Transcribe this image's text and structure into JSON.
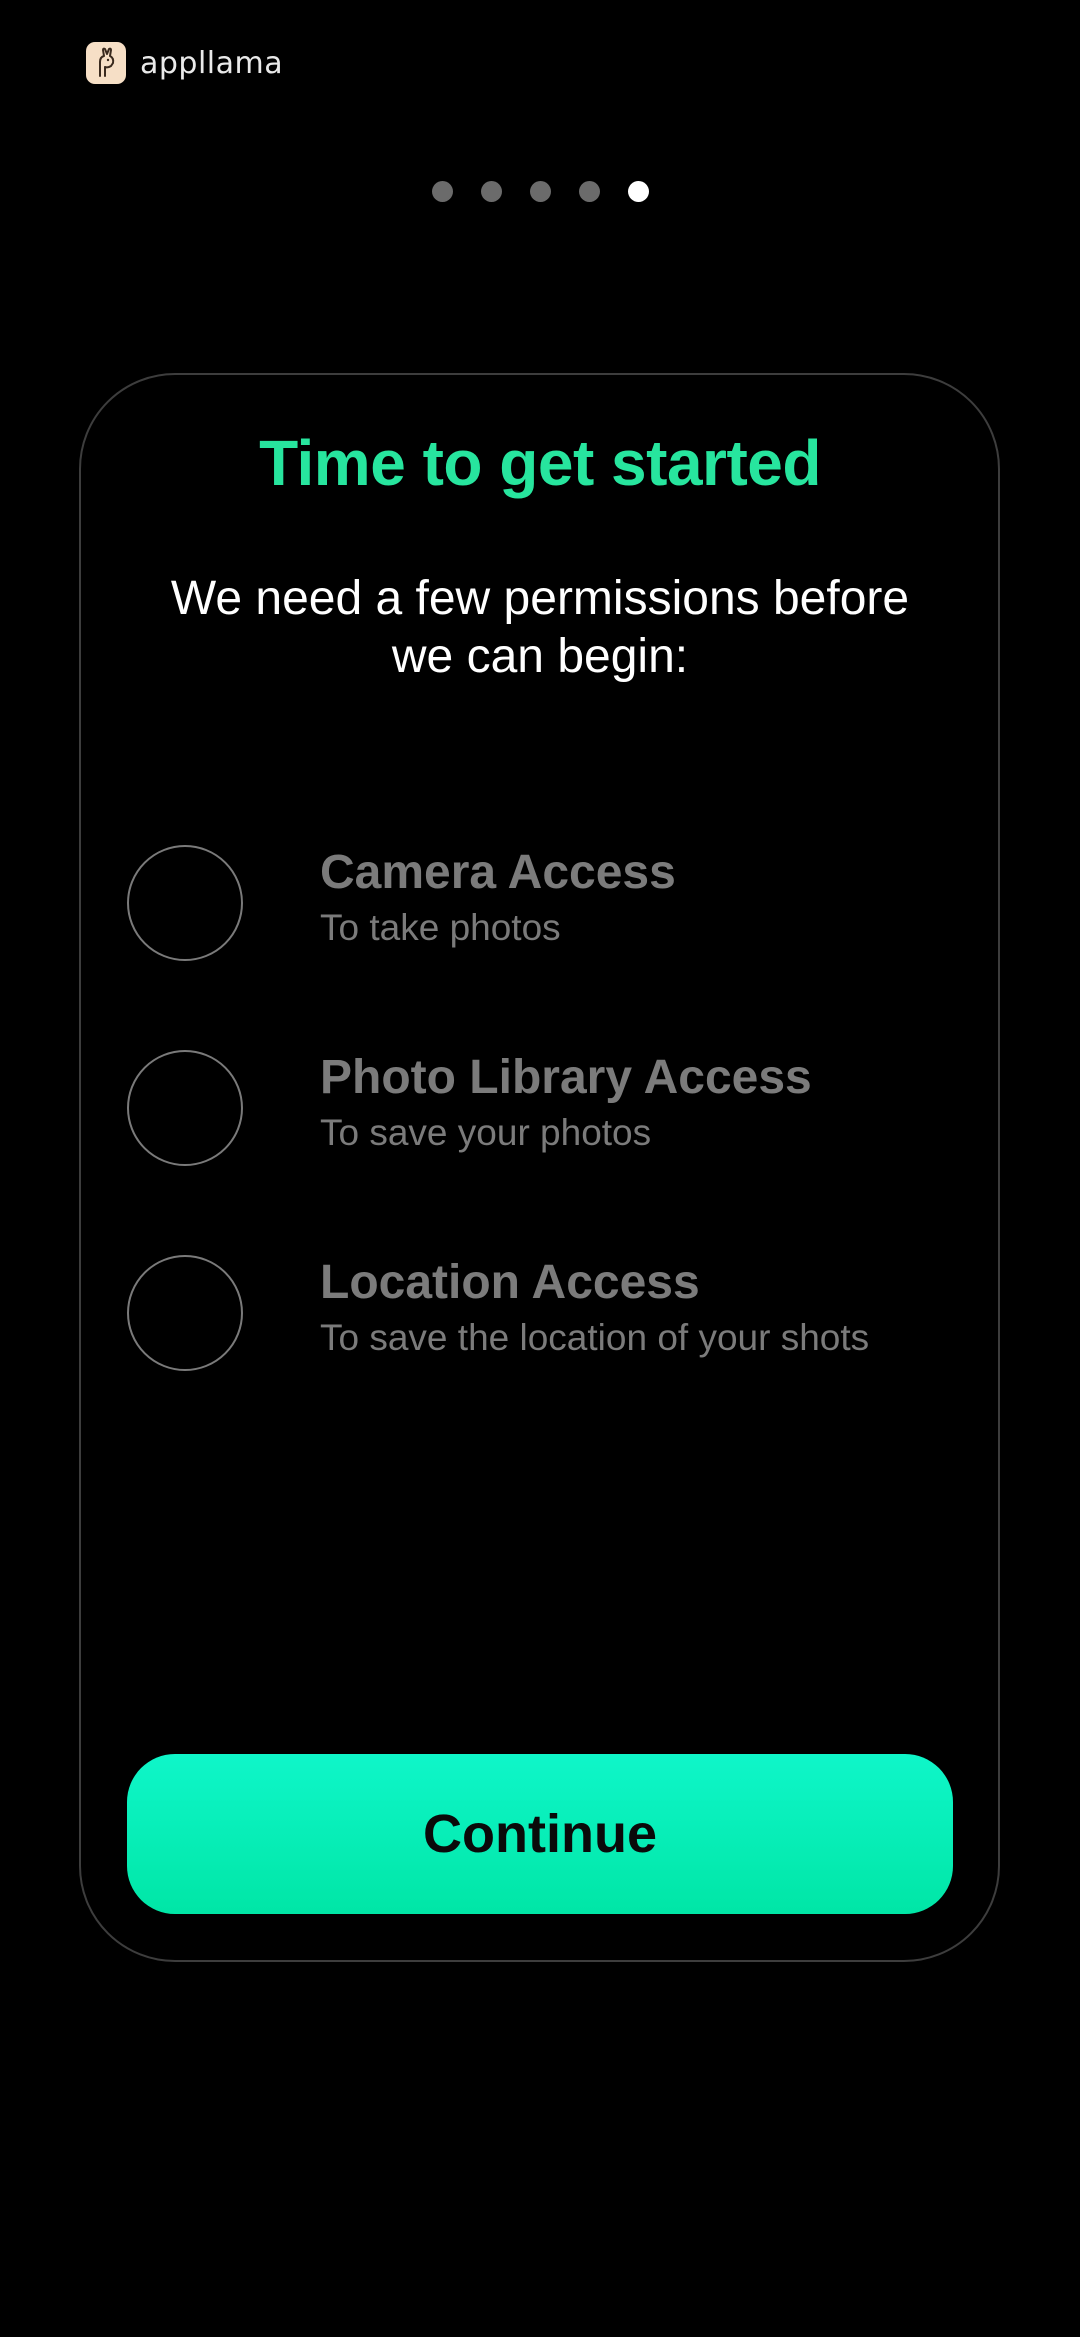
{
  "brand": {
    "name": "appllama",
    "logo_icon": "llama-icon",
    "logo_color": "#f6dfc6"
  },
  "pager": {
    "total": 5,
    "current": 5
  },
  "card": {
    "title": "Time to get started",
    "subtitle": "We need a few permissions before we can begin:"
  },
  "permissions": [
    {
      "title": "Camera Access",
      "description": "To take photos",
      "granted": false
    },
    {
      "title": "Photo Library Access",
      "description": "To save your photos",
      "granted": false
    },
    {
      "title": "Location Access",
      "description": "To save the location of your shots",
      "granted": false
    }
  ],
  "actions": {
    "continue_label": "Continue"
  },
  "colors": {
    "accent_title": "#27e59e",
    "button_top": "#0ff6c9",
    "button_bottom": "#00e6a6",
    "muted_text": "#7b7b7b",
    "background": "#000000"
  }
}
